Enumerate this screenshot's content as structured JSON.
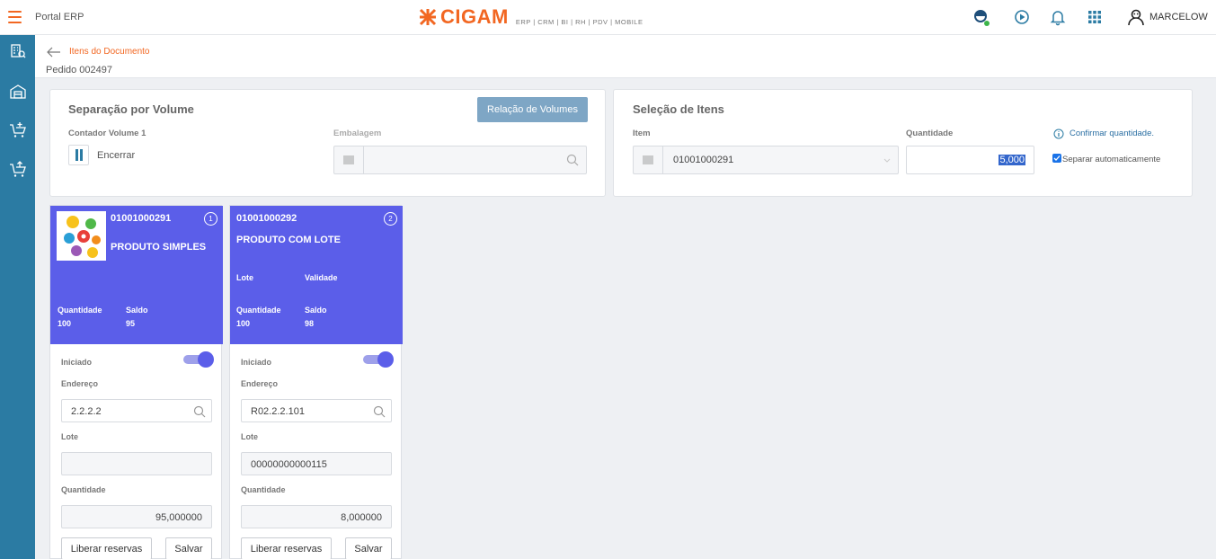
{
  "app": {
    "portal_title": "Portal ERP",
    "logo_text": "CIGAM",
    "logo_sub": "ERP | CRM | BI | RH | PDV | MOBILE",
    "user_name": "MARCELOW",
    "accent": "#f26722",
    "sidebar_color": "#2b7ba3",
    "card_color": "#5b5ee9"
  },
  "header": {
    "breadcrumb": "Itens do Documento",
    "order_title": "Pedido 002497"
  },
  "volume_panel": {
    "title": "Separação por Volume",
    "relation_button": "Relação de Volumes",
    "counter_label": "Contador Volume 1",
    "finish_label": "Encerrar",
    "package_label": "Embalagem",
    "package_value": ""
  },
  "items_panel": {
    "title": "Seleção de Itens",
    "item_label": "Item",
    "item_value": "01001000291",
    "quantity_label": "Quantidade",
    "quantity_value": "5,000",
    "confirm_label": "Confirmar quantidade.",
    "auto_separate_label": "Separar automaticamente"
  },
  "cards": [
    {
      "code": "01001000291",
      "badge": "1",
      "name": "PRODUTO SIMPLES",
      "quantity_label": "Quantidade",
      "quantity_value": "100",
      "balance_label": "Saldo",
      "balance_value": "95",
      "started_label": "Iniciado",
      "address_label": "Endereço",
      "address_value": "2.2.2.2",
      "lot_label": "Lote",
      "lot_value": "",
      "qty_label": "Quantidade",
      "qty_value": "95,000000",
      "release_button": "Liberar reservas",
      "save_button": "Salvar"
    },
    {
      "code": "01001000292",
      "badge": "2",
      "name": "PRODUTO COM LOTE",
      "lot_head_label": "Lote",
      "validity_label": "Validade",
      "quantity_label": "Quantidade",
      "quantity_value": "100",
      "balance_label": "Saldo",
      "balance_value": "98",
      "started_label": "Iniciado",
      "address_label": "Endereço",
      "address_value": "R02.2.2.101",
      "lot_label": "Lote",
      "lot_value": "00000000000115",
      "qty_label": "Quantidade",
      "qty_value": "8,000000",
      "release_button": "Liberar reservas",
      "save_button": "Salvar"
    }
  ]
}
